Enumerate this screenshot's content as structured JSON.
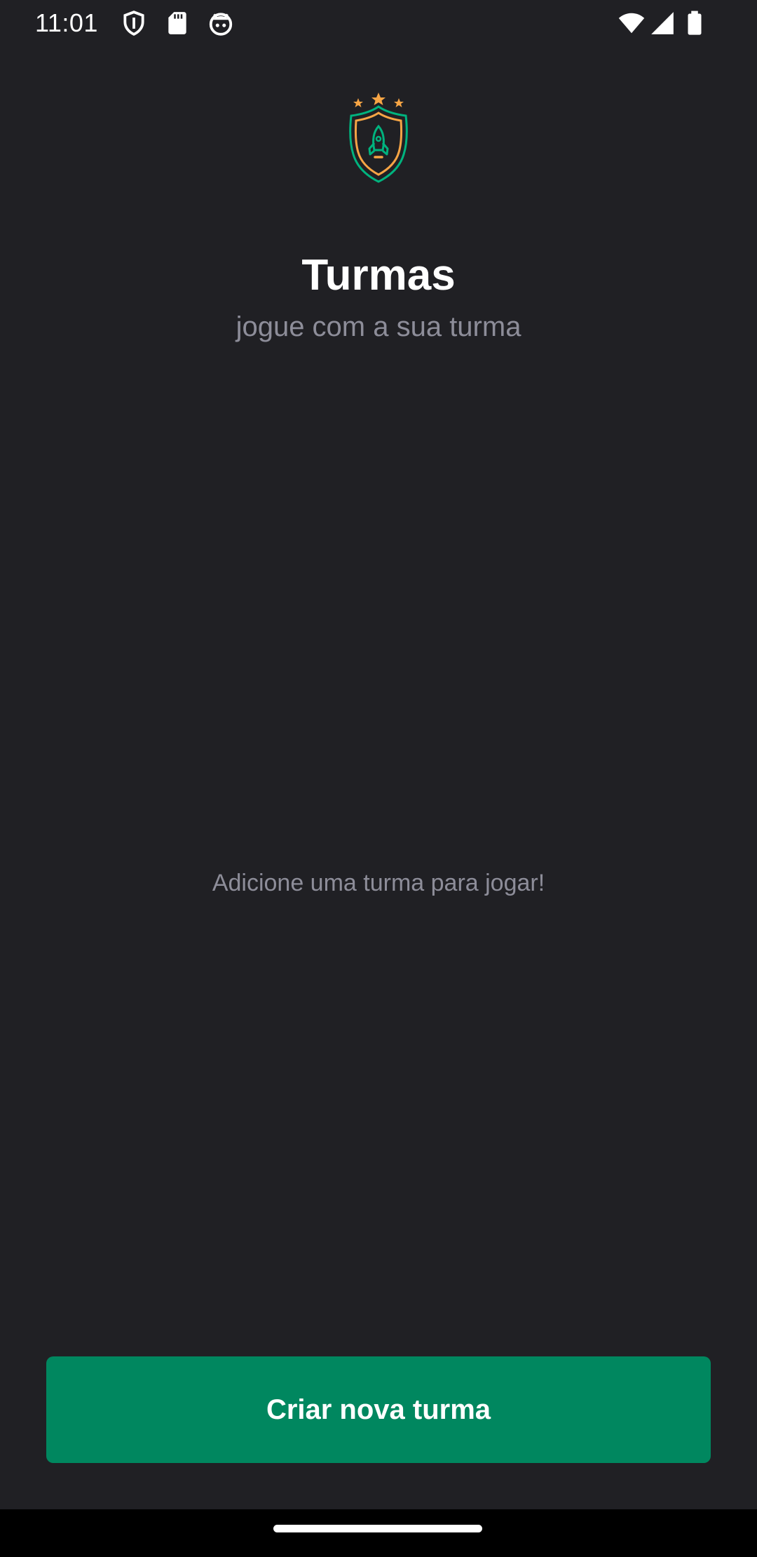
{
  "status_bar": {
    "time": "11:01",
    "left_icons": [
      "shield-icon",
      "sd-card-icon",
      "android-face-icon"
    ],
    "right_icons": [
      "wifi-icon",
      "cell-signal-icon",
      "battery-icon"
    ]
  },
  "header": {
    "logo_icon": "rocket-shield-logo-icon",
    "title": "Turmas",
    "subtitle": "jogue com a sua turma"
  },
  "main": {
    "empty_message": "Adicione uma turma para jogar!"
  },
  "actions": {
    "create_button_label": "Criar nova turma"
  },
  "colors": {
    "background": "#202024",
    "primary": "#00875f",
    "text": "#ffffff",
    "muted_text": "#8d8d99",
    "logo_green": "#00b37e",
    "logo_orange": "#f7a545"
  }
}
